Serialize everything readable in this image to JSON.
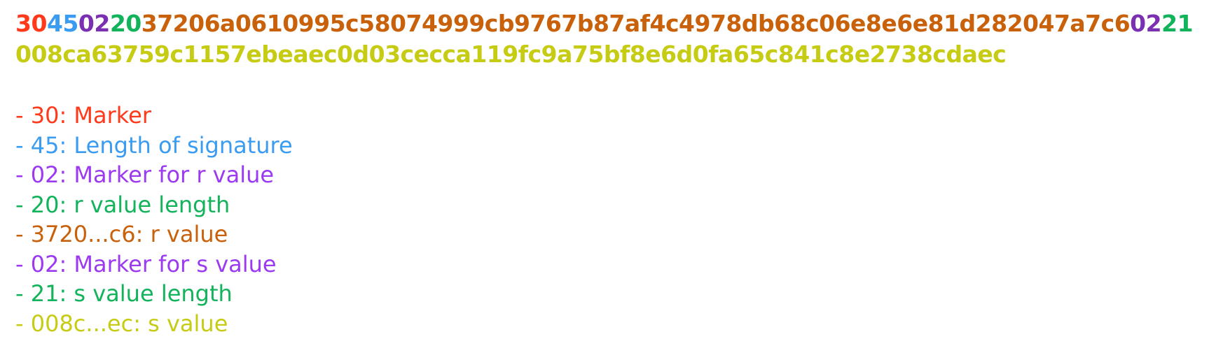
{
  "colors": {
    "marker": "#ff3a1a",
    "length": "#3a9cf0",
    "int_marker": "#9b3af0",
    "int_marker_hex": "#7a30b0",
    "int_length": "#12b35a",
    "r_value": "#c8610a",
    "s_value": "#c6cc14"
  },
  "signature": {
    "segments": [
      {
        "text": "30",
        "color_key": "marker"
      },
      {
        "text": "45",
        "color_key": "length"
      },
      {
        "text": "02",
        "color_key": "int_marker_hex"
      },
      {
        "text": "20",
        "color_key": "int_length"
      },
      {
        "text": "37206a0610995c58074999cb9767b87af4c4978db68c06e8e6e81d282047a7c6",
        "color_key": "r_value"
      },
      {
        "text": "02",
        "color_key": "int_marker_hex"
      },
      {
        "text": "21",
        "color_key": "int_length"
      },
      {
        "text": "008ca63759c1157ebeaec0d03cecca119fc9a75bf8e6d0fa65c841c8e2738cdaec",
        "color_key": "s_value"
      }
    ]
  },
  "legend": [
    {
      "text": "- 30: Marker",
      "color_key": "marker"
    },
    {
      "text": "- 45: Length of signature",
      "color_key": "length"
    },
    {
      "text": "- 02: Marker for r value",
      "color_key": "int_marker"
    },
    {
      "text": "- 20: r value length",
      "color_key": "int_length"
    },
    {
      "text": "- 3720...c6: r value",
      "color_key": "r_value"
    },
    {
      "text": "- 02: Marker for s value",
      "color_key": "int_marker"
    },
    {
      "text": "- 21: s value length",
      "color_key": "int_length"
    },
    {
      "text": "- 008c...ec: s value",
      "color_key": "s_value"
    }
  ]
}
